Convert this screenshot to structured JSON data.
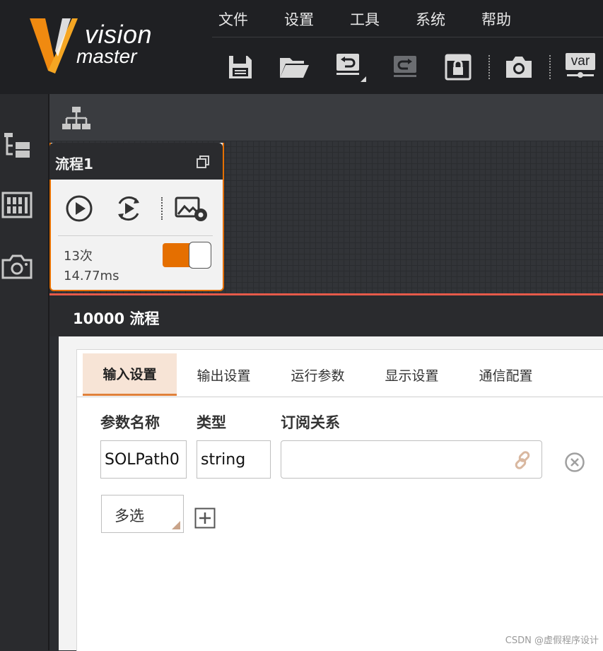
{
  "app": {
    "logo_word1": "vision",
    "logo_word2": "master"
  },
  "menu": [
    "文件",
    "设置",
    "工具",
    "系统",
    "帮助"
  ],
  "toolbar": {
    "icons": [
      "save-icon",
      "open-folder-icon",
      "undo-icon",
      "redo-icon",
      "lock-icon",
      "camera-icon",
      "var-icon"
    ],
    "var_label": "var"
  },
  "process_card": {
    "title": "流程1",
    "run_count": "13次",
    "run_time": "14.77ms",
    "toggle_on": true
  },
  "panel": {
    "title": "10000 流程",
    "tabs": [
      "输入设置",
      "输出设置",
      "运行参数",
      "显示设置",
      "通信配置"
    ],
    "active_tab": 0,
    "columns": {
      "name": "参数名称",
      "type": "类型",
      "subscription": "订阅关系"
    },
    "row": {
      "name": "SOLPath0",
      "type": "string",
      "subscription": ""
    },
    "multiselect_label": "多选"
  },
  "watermark": "CSDN @虚假程序设计",
  "colors": {
    "accent": "#e56f00",
    "header_bg": "#1f2023",
    "panel_line": "#e65a4a"
  }
}
